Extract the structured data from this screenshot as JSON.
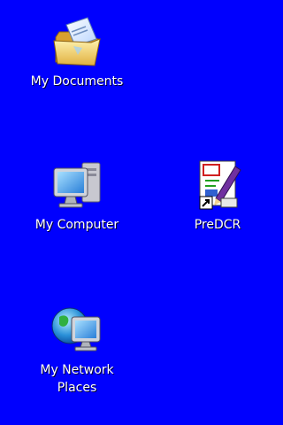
{
  "desktop": {
    "background_color": "#0000fe",
    "icons": [
      {
        "label": "My Documents",
        "icon": "folder-documents-icon"
      },
      {
        "label": "My Computer",
        "icon": "computer-icon"
      },
      {
        "label": "PreDCR",
        "icon": "predcr-shortcut-icon"
      },
      {
        "label": "My Network\nPlaces",
        "icon": "network-places-icon"
      }
    ]
  }
}
